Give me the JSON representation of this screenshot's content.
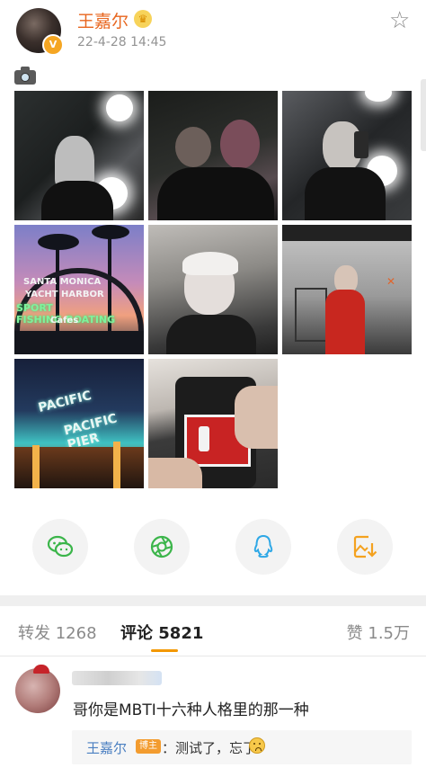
{
  "post": {
    "author": "王嘉尔",
    "time": "22-4-28 14:45",
    "photo_count": 8
  },
  "share": {
    "icons": [
      "wechat-icon",
      "moments-icon",
      "qq-icon",
      "save-image-icon"
    ]
  },
  "tabs": {
    "repost": "转发 1268",
    "comments": "评论 5821",
    "likes": "赞 1.5万"
  },
  "comment": {
    "text": "哥你是MBTI十六种人格里的那一种",
    "reply": {
      "author": "王嘉尔",
      "badge": "博主",
      "text": "：测试了，忘了"
    }
  },
  "colors": {
    "author_orange": "#e8661f",
    "accent_orange": "#f39800",
    "reply_blue": "#4a7fc1"
  }
}
